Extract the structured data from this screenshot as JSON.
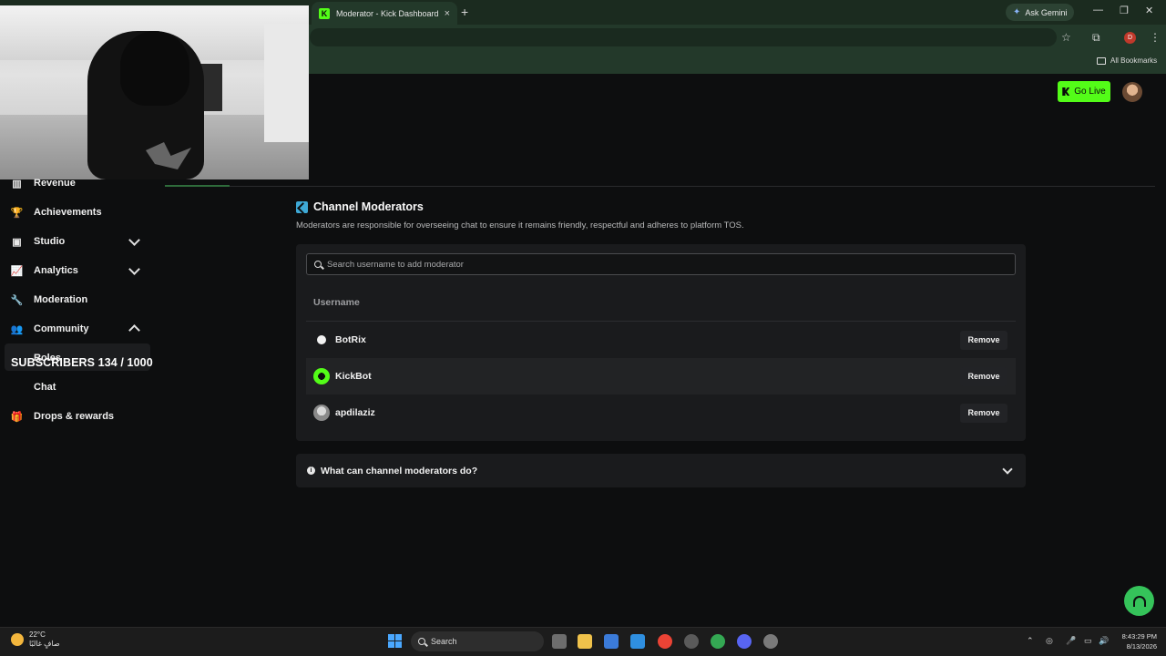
{
  "browser": {
    "tab_title": "Moderator - Kick Dashboard",
    "tab_favicon": "K",
    "new_tab": "+",
    "close_tab": "×",
    "ask_gemini": "Ask Gemini",
    "profile_initial": "D",
    "all_bookmarks": "All Bookmarks"
  },
  "header": {
    "go_live_label": "Go Live"
  },
  "overlay": {
    "subscribers": "SUBSCRIBERS 134 / 1000"
  },
  "sidebar": {
    "items": [
      {
        "label": "Revenue",
        "icon": "bar-chart-icon",
        "glyph": "▥"
      },
      {
        "label": "Achievements",
        "icon": "trophy-icon",
        "glyph": "🏆"
      },
      {
        "label": "Studio",
        "icon": "studio-icon",
        "glyph": "▣"
      },
      {
        "label": "Analytics",
        "icon": "analytics-icon",
        "glyph": "📈"
      },
      {
        "label": "Moderation",
        "icon": "wrench-icon",
        "glyph": "🔧"
      },
      {
        "label": "Community",
        "icon": "people-icon",
        "glyph": "👥"
      },
      {
        "label": "Drops & rewards",
        "icon": "gift-icon",
        "glyph": "🎁"
      }
    ],
    "sub_items": [
      "Roles",
      "Chat"
    ]
  },
  "main": {
    "title": "Channel Moderators",
    "description": "Moderators are responsible for overseeing chat to ensure it remains friendly, respectful and adheres to platform TOS.",
    "search_placeholder": "Search username to add moderator",
    "column_header": "Username",
    "moderators": [
      {
        "name": "BotRix",
        "action": "Remove"
      },
      {
        "name": "KickBot",
        "action": "Remove"
      },
      {
        "name": "apdilaziz",
        "action": "Remove"
      }
    ],
    "faq_label": "What can channel moderators do?"
  },
  "taskbar": {
    "temperature": "22°C",
    "weather_desc": "صافٍ غالبًا",
    "search_label": "Search",
    "time": "8:43:29 PM",
    "date": "8/13/2026"
  },
  "colors": {
    "kick_green": "#53fc18",
    "background": "#0d0e0f",
    "panel": "#1a1b1d",
    "accent_blue": "#3ea9d6"
  }
}
